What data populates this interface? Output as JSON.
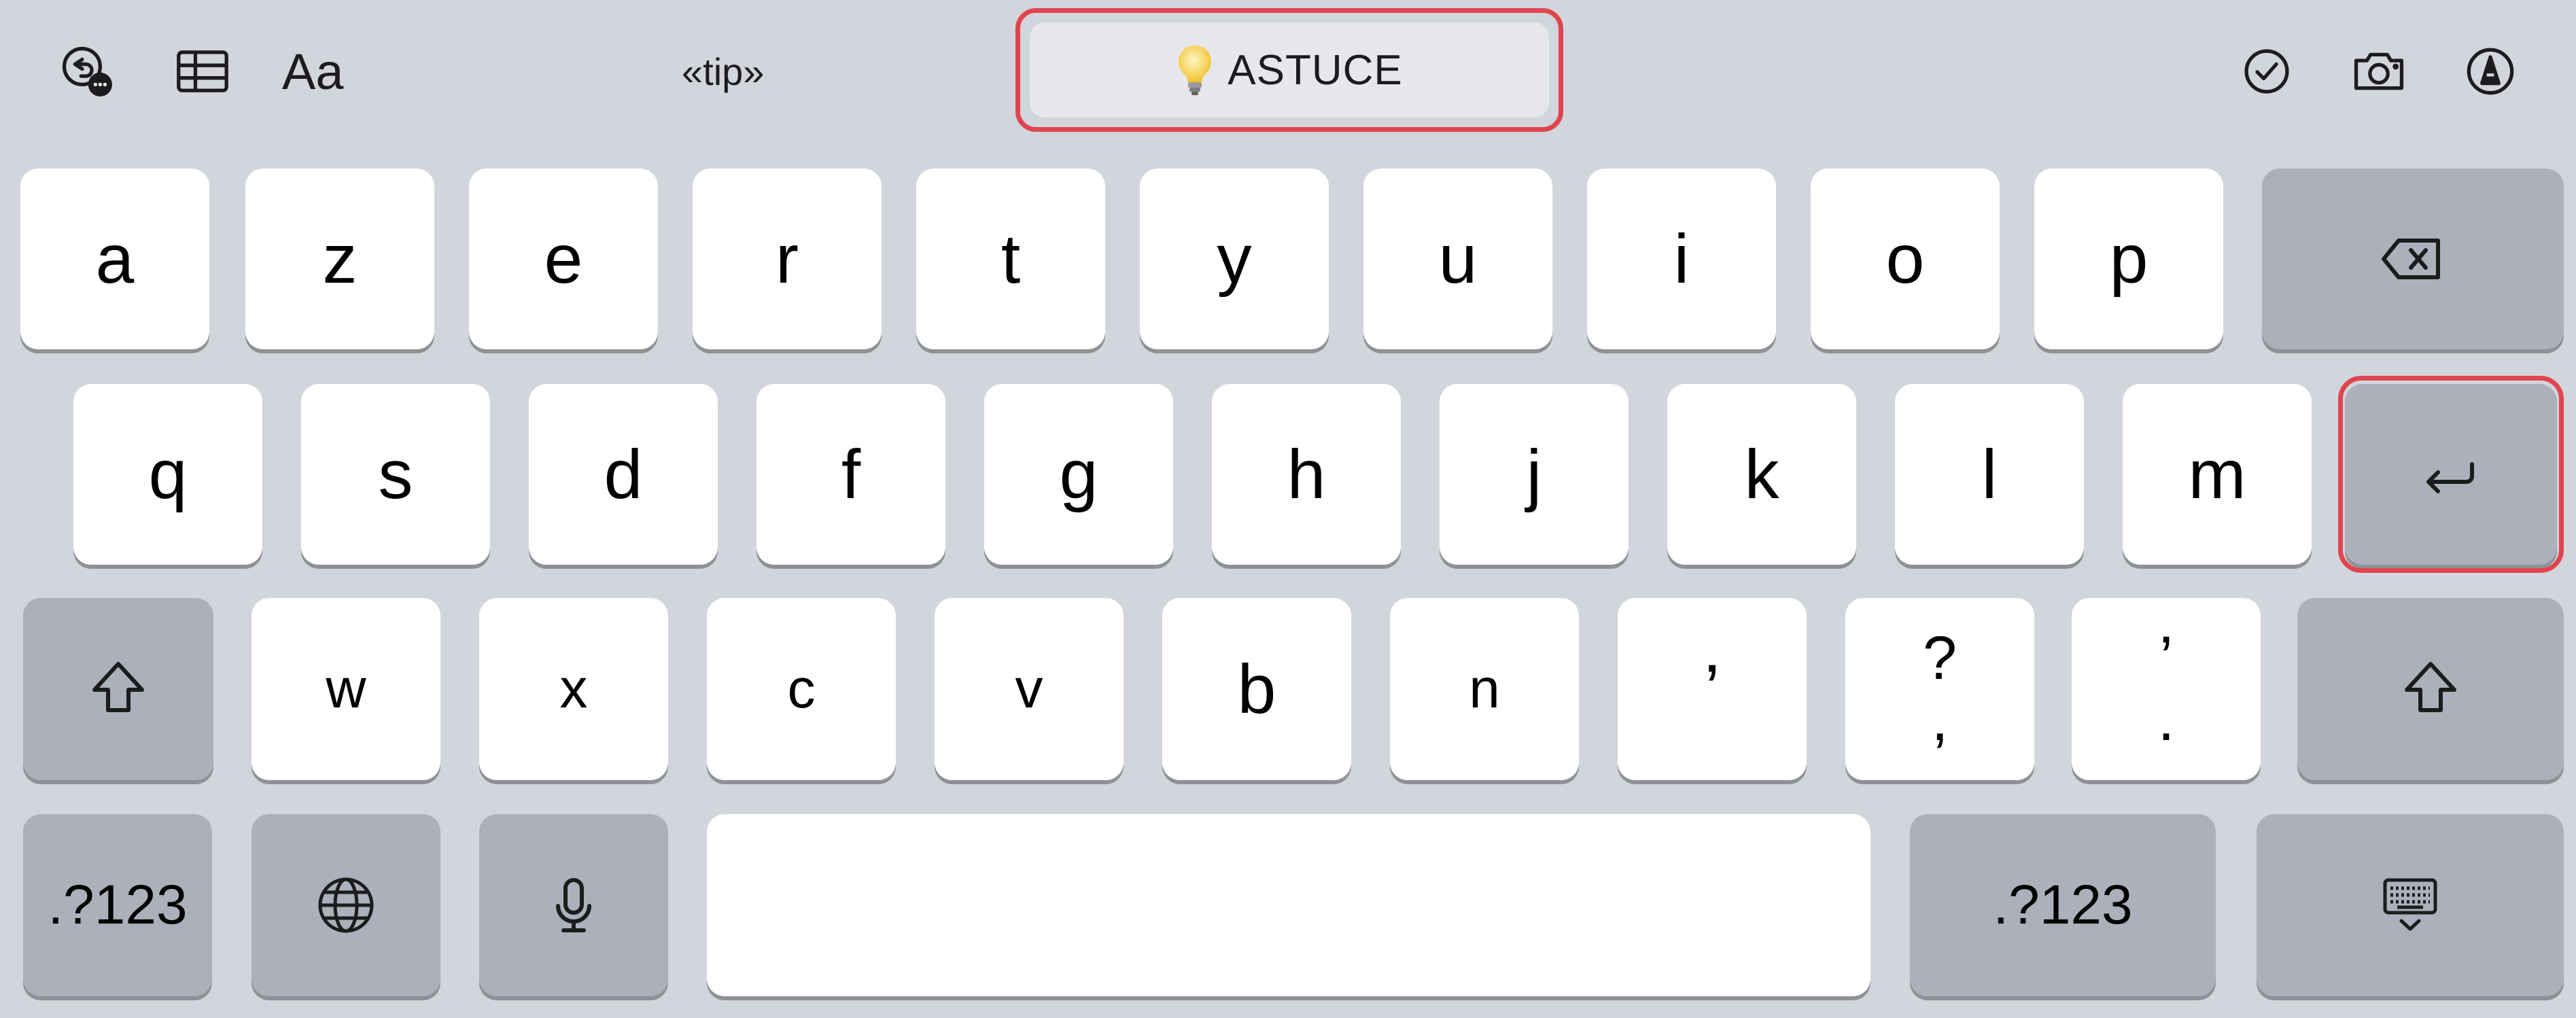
{
  "toolbar": {
    "undo_icon": "undo-more-icon",
    "table_icon": "table-icon",
    "format_label": "Aa",
    "prediction_left": "«tip»",
    "suggestion": {
      "icon": "lightbulb-icon",
      "label": "ASTUCE"
    },
    "checklist_icon": "checklist-icon",
    "camera_icon": "camera-icon",
    "markup_icon": "markup-pen-icon"
  },
  "keyboard": {
    "row1": [
      "a",
      "z",
      "e",
      "r",
      "t",
      "y",
      "u",
      "i",
      "o",
      "p"
    ],
    "row2": [
      "q",
      "s",
      "d",
      "f",
      "g",
      "h",
      "j",
      "k",
      "l",
      "m"
    ],
    "row3": [
      "w",
      "x",
      "c",
      "v",
      "b",
      "n",
      "’"
    ],
    "row3_punct1": {
      "top": "?",
      "bottom": ","
    },
    "row3_punct2": {
      "top": "’",
      "bottom": "."
    },
    "numbers_left": ".?123",
    "numbers_right": ".?123",
    "space_label": "",
    "icons": {
      "delete": "delete-backspace-icon",
      "return": "return-icon",
      "shift": "shift-arrow-icon",
      "globe": "globe-icon",
      "mic": "microphone-icon",
      "dismiss": "keyboard-dismiss-icon"
    }
  },
  "colors": {
    "background": "#d2d5db",
    "key": "#ffffff",
    "dark_key": "#abb0ba",
    "highlight": "#e0454f"
  }
}
